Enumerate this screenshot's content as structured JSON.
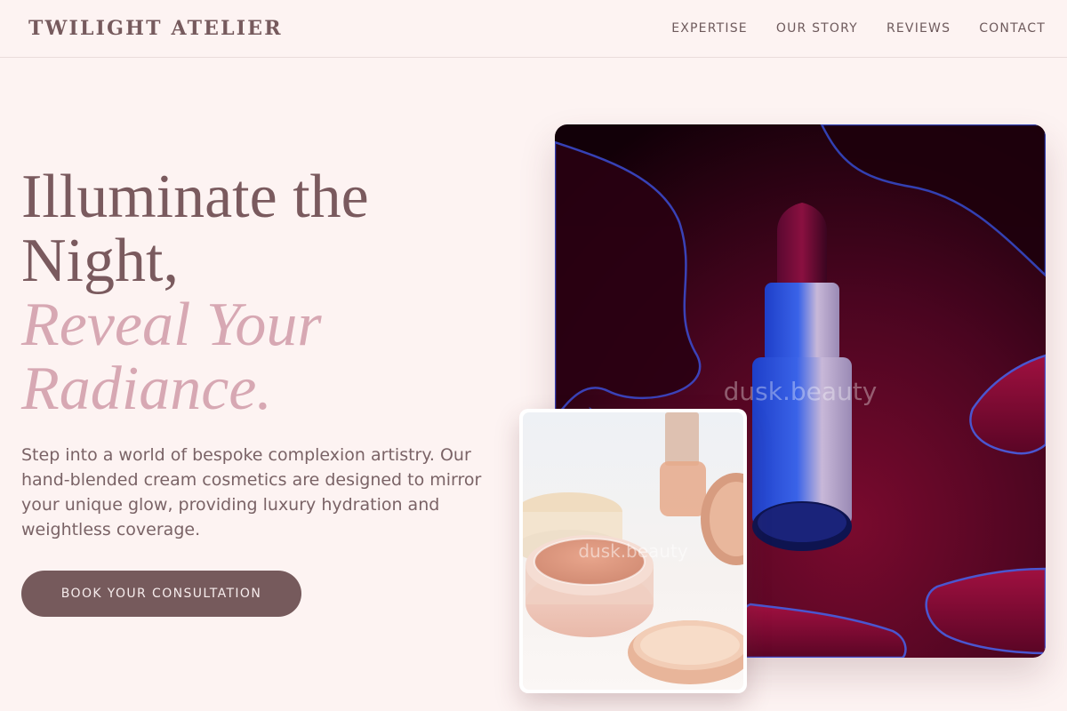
{
  "header": {
    "brand": "TWILIGHT ATELIER",
    "nav": [
      "EXPERTISE",
      "OUR STORY",
      "REVIEWS",
      "CONTACT"
    ]
  },
  "hero": {
    "title_line1": "Illuminate the",
    "title_line2": "Night,",
    "accent_line1": "Reveal Your",
    "accent_line2": "Radiance.",
    "description": "Step into a world of bespoke complexion artistry. Our hand-blended cream cosmetics are designed to mirror your unique glow, providing luxury hydration and weightless coverage.",
    "cta_label": "BOOK YOUR CONSULTATION"
  },
  "images": {
    "main_watermark": "dusk.beauty",
    "inset_watermark": "dusk.beauty"
  },
  "colors": {
    "background": "#fdf3f2",
    "brand": "#765a5d",
    "accent": "#d7a8b3",
    "cta": "#765a5c"
  }
}
